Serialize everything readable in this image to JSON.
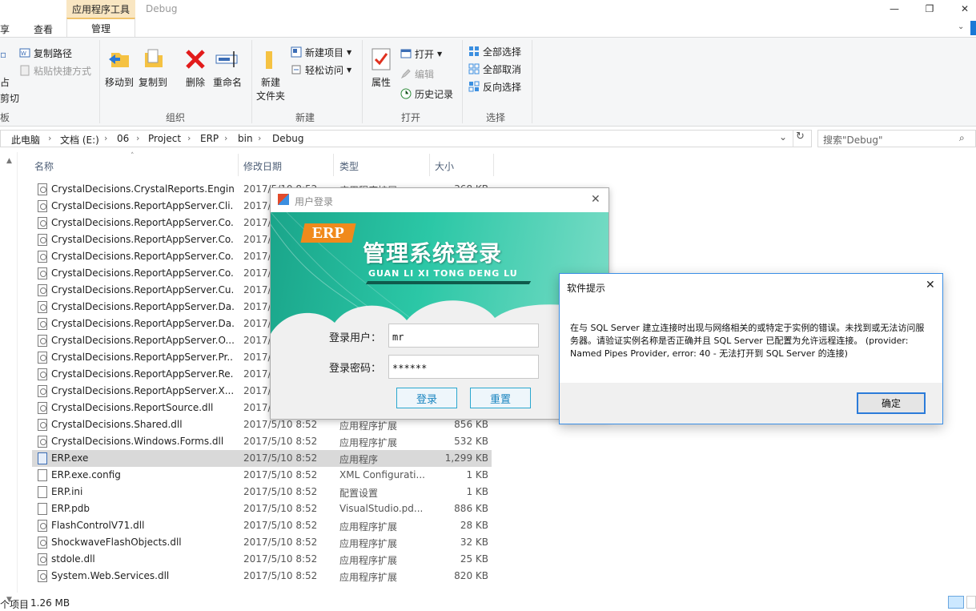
{
  "window": {
    "title": "Debug",
    "context_tab_header": "应用程序工具",
    "min_glyph": "—",
    "max_glyph": "❐",
    "close_glyph": "✕"
  },
  "ribbon_tabs": [
    "享",
    "查看",
    "管理"
  ],
  "ribbon": {
    "clipboard_partial": {
      "copy_path": "复制路径",
      "paste_shortcut": "粘贴快捷方式",
      "left_1": "占",
      "left_2": "剪切",
      "group": "板"
    },
    "organize": {
      "move_to": "移动到",
      "copy_to": "复制到",
      "delete": "删除",
      "rename": "重命名",
      "group": "组织"
    },
    "new": {
      "new_folder_l1": "新建",
      "new_folder_l2": "文件夹",
      "new_item": "新建项目",
      "easy_access": "轻松访问",
      "group": "新建"
    },
    "open": {
      "properties": "属性",
      "open": "打开",
      "edit": "编辑",
      "history": "历史记录",
      "group": "打开"
    },
    "select": {
      "select_all": "全部选择",
      "select_none": "全部取消",
      "invert": "反向选择",
      "group": "选择"
    }
  },
  "address": {
    "crumbs": [
      "此电脑",
      "文档 (E:)",
      "06",
      "Project",
      "ERP",
      "bin",
      "Debug"
    ],
    "search_placeholder": "搜索\"Debug\""
  },
  "columns": {
    "name": "名称",
    "date": "修改日期",
    "type": "类型",
    "size": "大小"
  },
  "files": [
    {
      "name": "CrystalDecisions.CrystalReports.Engin...",
      "date": "2017/5/10 8:52",
      "type": "应用程序扩展",
      "size": "368 KB",
      "kind": "dll"
    },
    {
      "name": "CrystalDecisions.ReportAppServer.Cli...",
      "date": "2017/",
      "type": "",
      "size": "",
      "kind": "dll"
    },
    {
      "name": "CrystalDecisions.ReportAppServer.Co...",
      "date": "2017/",
      "type": "",
      "size": "",
      "kind": "dll"
    },
    {
      "name": "CrystalDecisions.ReportAppServer.Co...",
      "date": "2017/",
      "type": "",
      "size": "",
      "kind": "dll"
    },
    {
      "name": "CrystalDecisions.ReportAppServer.Co...",
      "date": "2017/",
      "type": "",
      "size": "",
      "kind": "dll"
    },
    {
      "name": "CrystalDecisions.ReportAppServer.Co...",
      "date": "2017/",
      "type": "",
      "size": "",
      "kind": "dll"
    },
    {
      "name": "CrystalDecisions.ReportAppServer.Cu...",
      "date": "2017/",
      "type": "",
      "size": "",
      "kind": "dll"
    },
    {
      "name": "CrystalDecisions.ReportAppServer.Da...",
      "date": "2017/",
      "type": "",
      "size": "",
      "kind": "dll"
    },
    {
      "name": "CrystalDecisions.ReportAppServer.Da...",
      "date": "2017/",
      "type": "",
      "size": "",
      "kind": "dll"
    },
    {
      "name": "CrystalDecisions.ReportAppServer.O...",
      "date": "2017/",
      "type": "",
      "size": "",
      "kind": "dll"
    },
    {
      "name": "CrystalDecisions.ReportAppServer.Pr...",
      "date": "2017/",
      "type": "",
      "size": "",
      "kind": "dll"
    },
    {
      "name": "CrystalDecisions.ReportAppServer.Re...",
      "date": "2017/",
      "type": "",
      "size": "",
      "kind": "dll"
    },
    {
      "name": "CrystalDecisions.ReportAppServer.X...",
      "date": "2017/",
      "type": "",
      "size": "",
      "kind": "dll"
    },
    {
      "name": "CrystalDecisions.ReportSource.dll",
      "date": "2017/",
      "type": "",
      "size": "",
      "kind": "dll"
    },
    {
      "name": "CrystalDecisions.Shared.dll",
      "date": "2017/5/10 8:52",
      "type": "应用程序扩展",
      "size": "856 KB",
      "kind": "dll"
    },
    {
      "name": "CrystalDecisions.Windows.Forms.dll",
      "date": "2017/5/10 8:52",
      "type": "应用程序扩展",
      "size": "532 KB",
      "kind": "dll"
    },
    {
      "name": "ERP.exe",
      "date": "2017/5/10 8:52",
      "type": "应用程序",
      "size": "1,299 KB",
      "kind": "exe"
    },
    {
      "name": "ERP.exe.config",
      "date": "2017/5/10 8:52",
      "type": "XML Configurati...",
      "size": "1 KB",
      "kind": "cfg"
    },
    {
      "name": "ERP.ini",
      "date": "2017/5/10 8:52",
      "type": "配置设置",
      "size": "1 KB",
      "kind": "ini"
    },
    {
      "name": "ERP.pdb",
      "date": "2017/5/10 8:52",
      "type": "VisualStudio.pd...",
      "size": "886 KB",
      "kind": "pdb"
    },
    {
      "name": "FlashControlV71.dll",
      "date": "2017/5/10 8:52",
      "type": "应用程序扩展",
      "size": "28 KB",
      "kind": "dll"
    },
    {
      "name": "ShockwaveFlashObjects.dll",
      "date": "2017/5/10 8:52",
      "type": "应用程序扩展",
      "size": "32 KB",
      "kind": "dll"
    },
    {
      "name": "stdole.dll",
      "date": "2017/5/10 8:52",
      "type": "应用程序扩展",
      "size": "25 KB",
      "kind": "dll"
    },
    {
      "name": "System.Web.Services.dll",
      "date": "2017/5/10 8:52",
      "type": "应用程序扩展",
      "size": "820 KB",
      "kind": "dll"
    }
  ],
  "status": {
    "count": "个项目",
    "size": "1.26 MB"
  },
  "login": {
    "title": "用户登录",
    "close_glyph": "✕",
    "logo": "ERP",
    "heading": "管理系统登录",
    "pinyin": "GUAN LI XI TONG DENG LU",
    "user_label": "登录用户：",
    "user_value": "mr",
    "pass_label": "登录密码：",
    "pass_value": "******",
    "login_button": "登录",
    "reset_button": "重置"
  },
  "msgbox": {
    "title": "软件提示",
    "close_glyph": "✕",
    "message": "在与 SQL Server 建立连接时出现与网络相关的或特定于实例的错误。未找到或无法访问服务器。请验证实例名称是否正确并且 SQL Server 已配置为允许远程连接。 (provider: Named Pipes Provider, error: 40 - 无法打开到 SQL Server 的连接)",
    "ok_button": "确定"
  }
}
